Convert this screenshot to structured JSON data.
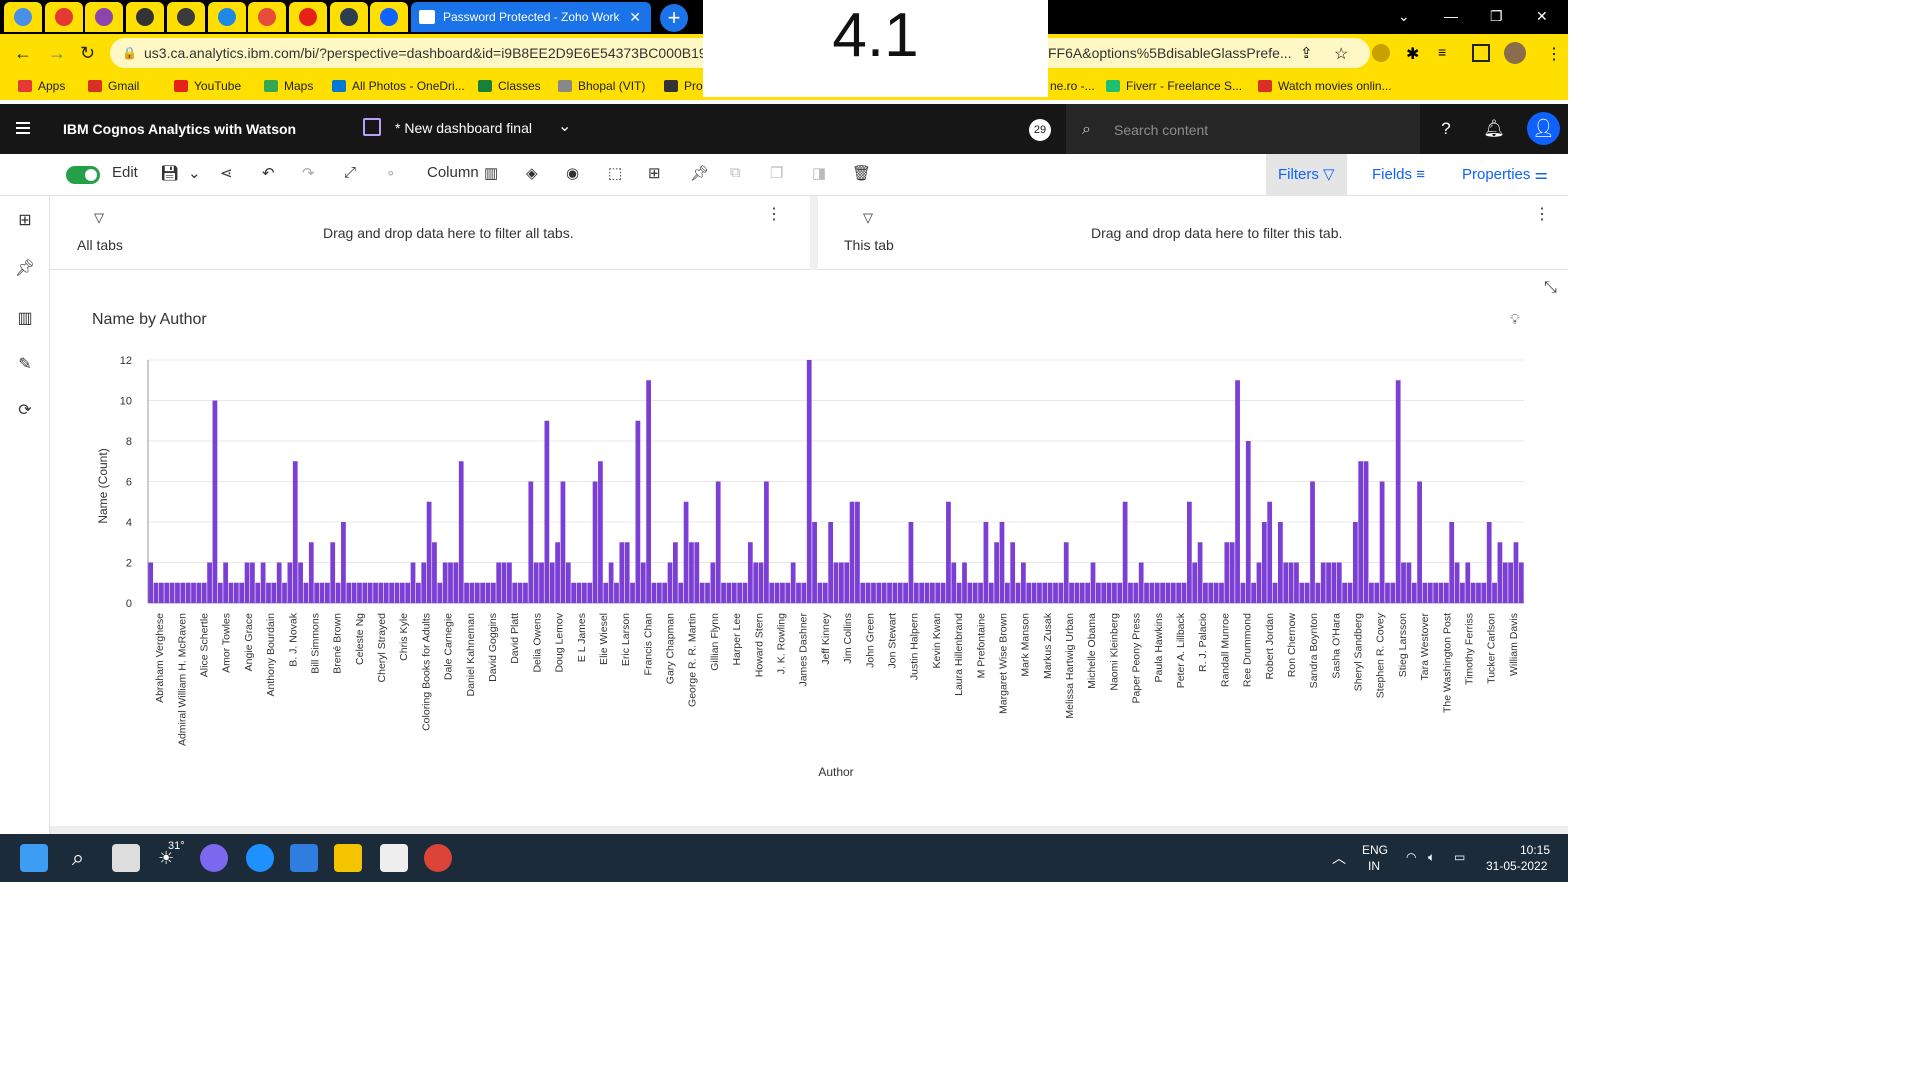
{
  "browser": {
    "tabs": [
      {
        "icon": "mail-icon",
        "color": "#4a8fe7"
      },
      {
        "icon": "alert-icon",
        "color": "#e53935"
      },
      {
        "icon": "shield-icon",
        "color": "#8e44ad"
      },
      {
        "icon": "github-icon",
        "color": "#333333"
      },
      {
        "icon": "mt-icon",
        "color": "#3b3b3b"
      },
      {
        "icon": "swoosh-icon",
        "color": "#1e88e5"
      },
      {
        "icon": "game-icon",
        "color": "#e74c3c"
      },
      {
        "icon": "youtube-icon",
        "color": "#e62117"
      },
      {
        "icon": "globe-icon",
        "color": "#2c3e50"
      },
      {
        "icon": "cognos-icon",
        "color": "#0f62fe"
      }
    ],
    "active_tab": {
      "title": "Password Protected - Zoho Work",
      "close": "✕"
    },
    "new_tab": "+",
    "url": "us3.ca.analytics.ibm.com/bi/?perspective=dashboard&id=i9B8EE2D9E6E54373BC000B19",
    "url_tail": "FF6A&options%5BdisableGlassPrefe...",
    "bookmarks": [
      {
        "label": "Apps",
        "color": "#e53935"
      },
      {
        "label": "Gmail",
        "color": "#d93025"
      },
      {
        "label": "YouTube",
        "color": "#e62117"
      },
      {
        "label": "Maps",
        "color": "#34a853"
      },
      {
        "label": "All Photos - OneDri...",
        "color": "#0078d4"
      },
      {
        "label": "Classes",
        "color": "#188038"
      },
      {
        "label": "Bhopal (VIT)",
        "color": "#888888"
      },
      {
        "label": "Prob",
        "color": "#333333"
      }
    ],
    "bookmarks_right": [
      {
        "label": "ne.ro -...",
        "color": "#ffdf00"
      },
      {
        "label": "Fiverr - Freelance S...",
        "color": "#1dbf73"
      },
      {
        "label": "Watch movies onlin...",
        "color": "#d93025"
      }
    ]
  },
  "overlay_text": "4.1",
  "app": {
    "brand": "IBM Cognos Analytics with Watson",
    "dashboard_name": "* New dashboard final",
    "notification_count": "29",
    "search_placeholder": "Search content"
  },
  "toolbar": {
    "edit_label": "Edit",
    "chart_type_label": "Column",
    "filters_label": "Filters",
    "fields_label": "Fields",
    "properties_label": "Properties"
  },
  "filters": {
    "all_tabs_label": "All tabs",
    "all_tabs_hint": "Drag and drop data here to filter all tabs.",
    "this_tab_label": "This tab",
    "this_tab_hint": "Drag and drop data here to filter this tab."
  },
  "chart_data": {
    "type": "bar",
    "title": "Name by Author",
    "xlabel": "Author",
    "ylabel": "Name (Count)",
    "ylim": [
      0,
      12
    ],
    "yticks": [
      0,
      2,
      4,
      6,
      8,
      10,
      12
    ],
    "color": "#7c3fd6",
    "values": [
      2,
      1,
      1,
      1,
      1,
      1,
      1,
      1,
      1,
      1,
      1,
      2,
      10,
      1,
      2,
      1,
      1,
      1,
      2,
      2,
      1,
      2,
      1,
      1,
      2,
      1,
      2,
      7,
      2,
      1,
      3,
      1,
      1,
      1,
      3,
      1,
      4,
      1,
      1,
      1,
      1,
      1,
      1,
      1,
      1,
      1,
      1,
      1,
      1,
      2,
      1,
      2,
      5,
      3,
      1,
      2,
      2,
      2,
      7,
      1,
      1,
      1,
      1,
      1,
      1,
      2,
      2,
      2,
      1,
      1,
      1,
      6,
      2,
      2,
      9,
      2,
      3,
      6,
      2,
      1,
      1,
      1,
      1,
      6,
      7,
      1,
      2,
      1,
      3,
      3,
      1,
      9,
      2,
      11,
      1,
      1,
      1,
      2,
      3,
      1,
      5,
      3,
      3,
      1,
      1,
      2,
      6,
      1,
      1,
      1,
      1,
      1,
      3,
      2,
      2,
      6,
      1,
      1,
      1,
      1,
      2,
      1,
      1,
      12,
      4,
      1,
      1,
      4,
      2,
      2,
      2,
      5,
      5,
      1,
      1,
      1,
      1,
      1,
      1,
      1,
      1,
      1,
      4,
      1,
      1,
      1,
      1,
      1,
      1,
      5,
      2,
      1,
      2,
      1,
      1,
      1,
      4,
      1,
      3,
      4,
      1,
      3,
      1,
      2,
      1,
      1,
      1,
      1,
      1,
      1,
      1,
      3,
      1,
      1,
      1,
      1,
      2,
      1,
      1,
      1,
      1,
      1,
      5,
      1,
      1,
      2,
      1,
      1,
      1,
      1,
      1,
      1,
      1,
      1,
      5,
      2,
      3,
      1,
      1,
      1,
      1,
      3,
      3,
      11,
      1,
      8,
      1,
      2,
      4,
      5,
      1,
      4,
      2,
      2,
      2,
      1,
      1,
      6,
      1,
      2,
      2,
      2,
      2,
      1,
      1,
      4,
      7,
      7,
      1,
      1,
      6,
      1,
      1,
      11,
      2,
      2,
      1,
      6,
      1,
      1,
      1,
      1,
      1,
      4,
      2,
      1,
      2,
      1,
      1,
      1,
      4,
      1,
      3,
      2,
      2,
      3,
      2
    ],
    "xtick_labels": [
      "Abraham Verghese",
      "Admiral William H. McRaven",
      "Alice Schertle",
      "Amor Towles",
      "Angie Grace",
      "Anthony Bourdain",
      "B. J. Novak",
      "Bill Simmons",
      "Brené Brown",
      "Celeste Ng",
      "Cheryl Strayed",
      "Chris Kyle",
      "Coloring Books for Adults",
      "Dale Carnegie",
      "Daniel Kahneman",
      "David Goggins",
      "David Platt",
      "Delia Owens",
      "Doug Lemov",
      "E L James",
      "Elie Wiesel",
      "Eric Larson",
      "Francis Chan",
      "Gary Chapman",
      "George R. R. Martin",
      "Gillian Flynn",
      "Harper Lee",
      "Howard Stern",
      "J. K. Rowling",
      "James Dashner",
      "Jeff Kinney",
      "Jim Collins",
      "John Green",
      "Jon Stewart",
      "Justin Halpern",
      "Kevin Kwan",
      "Laura Hillenbrand",
      "M Prefontaine",
      "Margaret Wise Brown",
      "Mark Manson",
      "Markus Zusak",
      "Melissa Hartwig Urban",
      "Michelle Obama",
      "Naomi Kleinberg",
      "Paper Peony Press",
      "Paula Hawkins",
      "Peter A. Lillback",
      "R. J. Palacio",
      "Randall Munroe",
      "Ree Drummond",
      "Robert Jordan",
      "Ron Chernow",
      "Sandra Boynton",
      "Sasha O'Hara",
      "Sheryl Sandberg",
      "Stephen R. Covey",
      "Stieg Larsson",
      "Tara Westover",
      "The Washington Post",
      "Timothy Ferriss",
      "Tucker Carlson",
      "William Davis"
    ]
  },
  "taskbar": {
    "weather": "31°",
    "lang": "ENG",
    "region": "IN",
    "time": "10:15",
    "date": "31-05-2022"
  }
}
